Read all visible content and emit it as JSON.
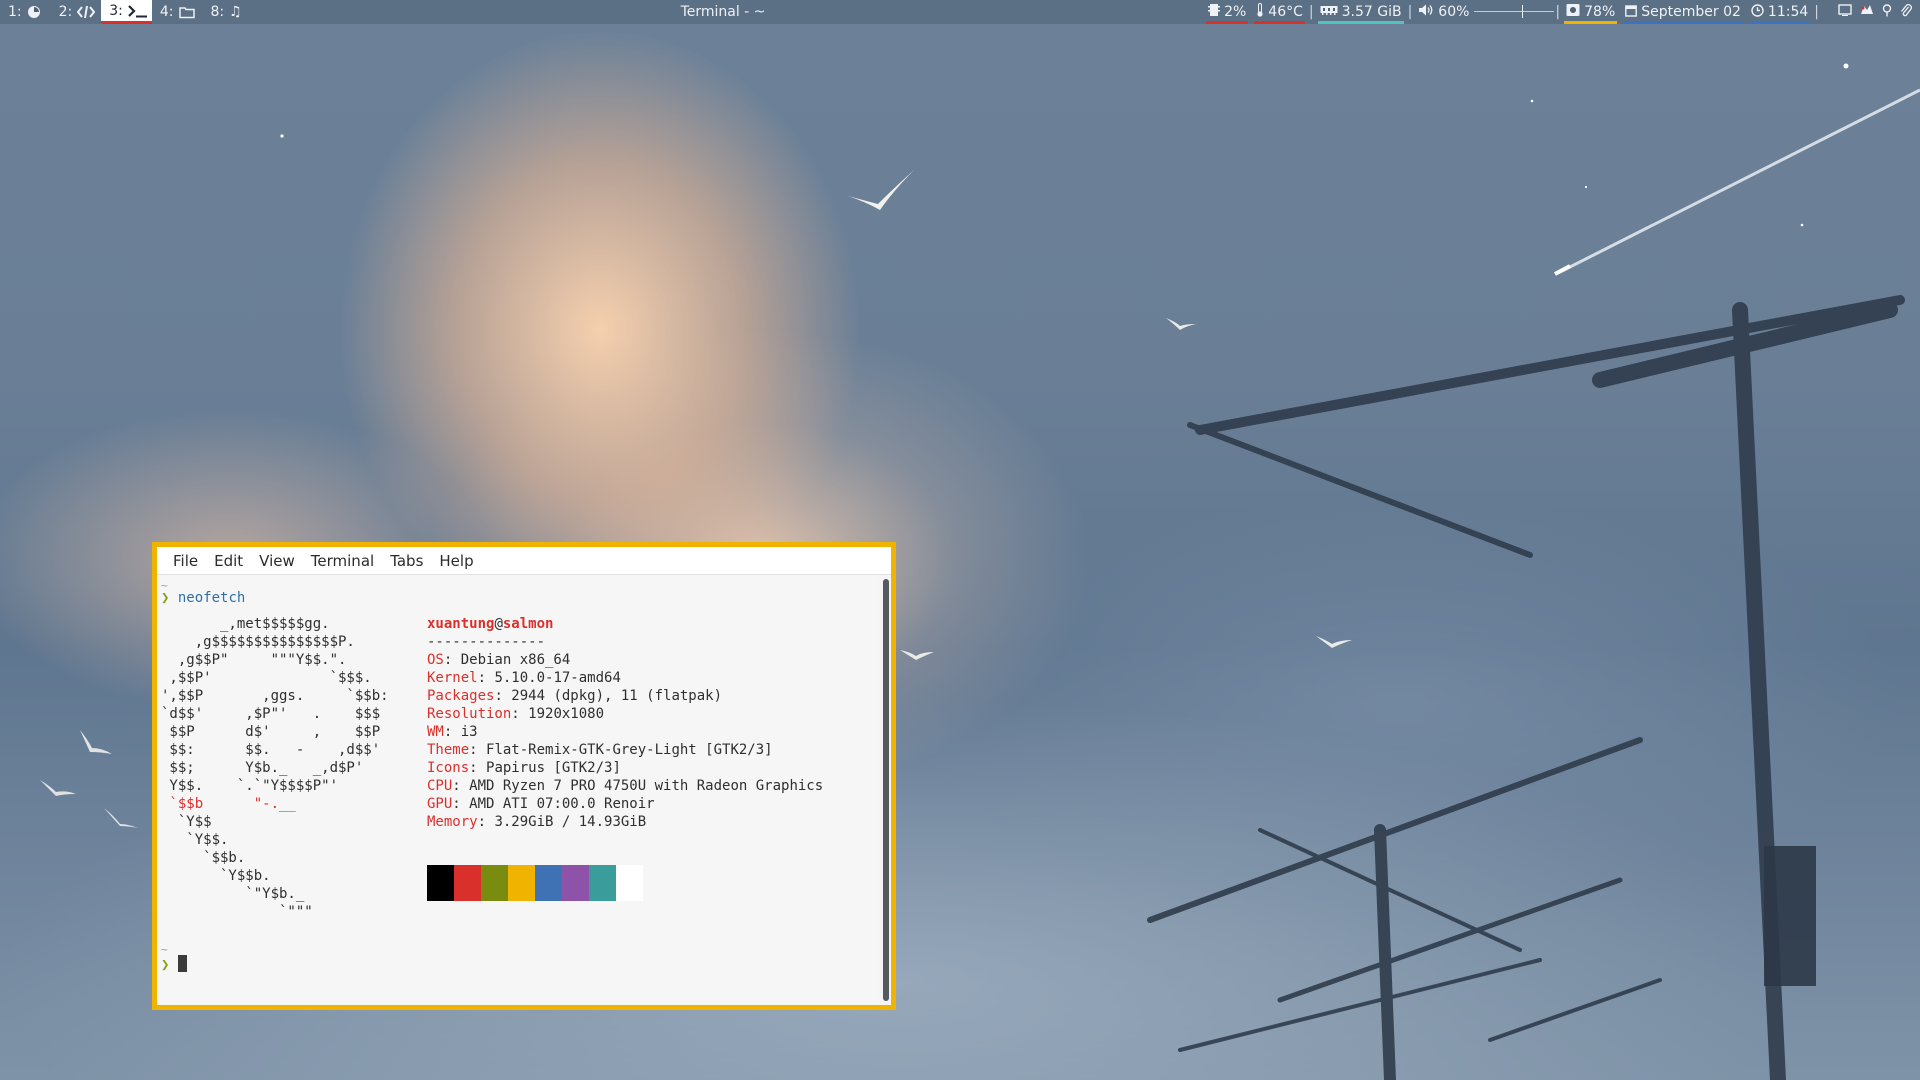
{
  "topbar": {
    "workspaces": [
      {
        "num": "1:",
        "icon": "clock-icon",
        "active": false
      },
      {
        "num": "2:",
        "icon": "code-icon",
        "active": false
      },
      {
        "num": "3:",
        "icon": "terminal-icon",
        "active": true
      },
      {
        "num": "4:",
        "icon": "folder-icon",
        "active": false
      },
      {
        "num": "8:",
        "icon": "music-note-icon",
        "active": false
      }
    ],
    "window_title": "Terminal - ~",
    "cpu": "2%",
    "temperature": "46°C",
    "memory": "3.57 GiB",
    "volume": "60%",
    "volume_level": 0.6,
    "brightness": "78%",
    "date": "September 02",
    "time": "11:54",
    "colors": {
      "cpu_underline": "#d9302c",
      "temp_underline": "#d9302c",
      "mem_underline": "#4fc4c0",
      "brightness_underline": "#f0b400",
      "clock_underline": "#3b72c4"
    }
  },
  "terminal": {
    "menu": [
      "File",
      "Edit",
      "View",
      "Terminal",
      "Tabs",
      "Help"
    ],
    "prompt_symbol": "❯",
    "tilde": "~",
    "command": "neofetch",
    "user": "xuantung",
    "at": "@",
    "host": "salmon",
    "separator": "--------------",
    "info": [
      {
        "key": "OS",
        "value": "Debian x86_64"
      },
      {
        "key": "Kernel",
        "value": "5.10.0-17-amd64"
      },
      {
        "key": "Packages",
        "value": "2944 (dpkg), 11 (flatpak)"
      },
      {
        "key": "Resolution",
        "value": "1920x1080"
      },
      {
        "key": "WM",
        "value": "i3"
      },
      {
        "key": "Theme",
        "value": "Flat-Remix-GTK-Grey-Light [GTK2/3]"
      },
      {
        "key": "Icons",
        "value": "Papirus [GTK2/3]"
      },
      {
        "key": "CPU",
        "value": "AMD Ryzen 7 PRO 4750U with Radeon Graphics"
      },
      {
        "key": "GPU",
        "value": "AMD ATI 07:00.0 Renoir"
      },
      {
        "key": "Memory",
        "value": "3.29GiB / 14.93GiB"
      }
    ],
    "ascii_art": [
      "       _,met$$$$$gg.",
      "    ,g$$$$$$$$$$$$$$$P.",
      "  ,g$$P\"     \"\"\"Y$$.\".",
      " ,$$P'              `$$$.",
      "',$$P       ,ggs.     `$$b:",
      "`d$$'     ,$P\"'   .    $$$",
      " $$P      d$'     ,    $$P",
      " $$:      $$.   -    ,d$$'",
      " $$;      Y$b._   _,d$P'",
      " Y$$.    `.`\"Y$$$$P\"'",
      " `$$b      \"-.__",
      "  `Y$$",
      "   `Y$$.",
      "     `$$b.",
      "       `Y$$b.",
      "          `\"Y$b._",
      "              `\"\"\""
    ],
    "palette": [
      "#000000",
      "#d9302c",
      "#7a8c10",
      "#f0b400",
      "#3f72b5",
      "#8e52a8",
      "#3b9c9c",
      "#ffffff"
    ]
  }
}
